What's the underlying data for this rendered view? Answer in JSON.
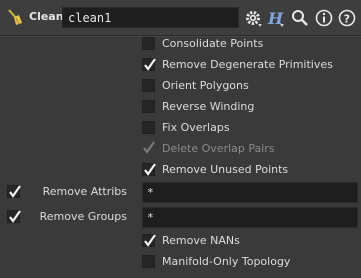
{
  "header": {
    "node_type": "Clean",
    "node_name": "clean1",
    "icons": [
      "broom-icon",
      "gear-icon",
      "help-h-icon",
      "search-icon",
      "info-icon",
      "help-icon"
    ]
  },
  "params": {
    "consolidate_points": {
      "label": "Consolidate Points",
      "checked": false
    },
    "remove_degenerate": {
      "label": "Remove Degenerate Primitives",
      "checked": true
    },
    "orient_polygons": {
      "label": "Orient Polygons",
      "checked": false
    },
    "reverse_winding": {
      "label": "Reverse Winding",
      "checked": false
    },
    "fix_overlaps": {
      "label": "Fix Overlaps",
      "checked": false
    },
    "delete_overlap_pairs": {
      "label": "Delete Overlap Pairs",
      "checked": true,
      "disabled": true
    },
    "remove_unused_points": {
      "label": "Remove Unused Points",
      "checked": true
    },
    "remove_attribs": {
      "label": "Remove Attribs",
      "enabled": true,
      "value": "*"
    },
    "remove_groups": {
      "label": "Remove Groups",
      "enabled": true,
      "value": "*"
    },
    "remove_nans": {
      "label": "Remove NANs",
      "checked": true
    },
    "manifold_only": {
      "label": "Manifold-Only Topology",
      "checked": false
    }
  }
}
